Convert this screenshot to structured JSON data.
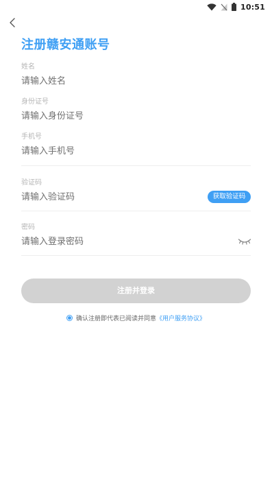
{
  "status_bar": {
    "time": "10:51"
  },
  "page": {
    "title": "注册赣安通账号"
  },
  "form": {
    "name": {
      "label": "姓名",
      "placeholder": "请输入姓名"
    },
    "id_number": {
      "label": "身份证号",
      "placeholder": "请输入身份证号"
    },
    "phone": {
      "label": "手机号",
      "placeholder": "请输入手机号"
    },
    "code": {
      "label": "验证码",
      "placeholder": "请输入验证码",
      "get_code_label": "获取验证码"
    },
    "password": {
      "label": "密码",
      "placeholder": "请输入登录密码"
    }
  },
  "submit_label": "注册并登录",
  "agreement": {
    "text": "确认注册即代表已阅读并同意",
    "link": "《用户服务协议》",
    "checked": true
  },
  "colors": {
    "accent": "#3f9ff4",
    "button_disabled": "#d2d2d2"
  },
  "icons": {
    "back": "chevron-left-icon",
    "eye": "eye-closed-icon",
    "wifi": "wifi-icon",
    "signal": "no-signal-icon",
    "battery": "battery-icon"
  }
}
